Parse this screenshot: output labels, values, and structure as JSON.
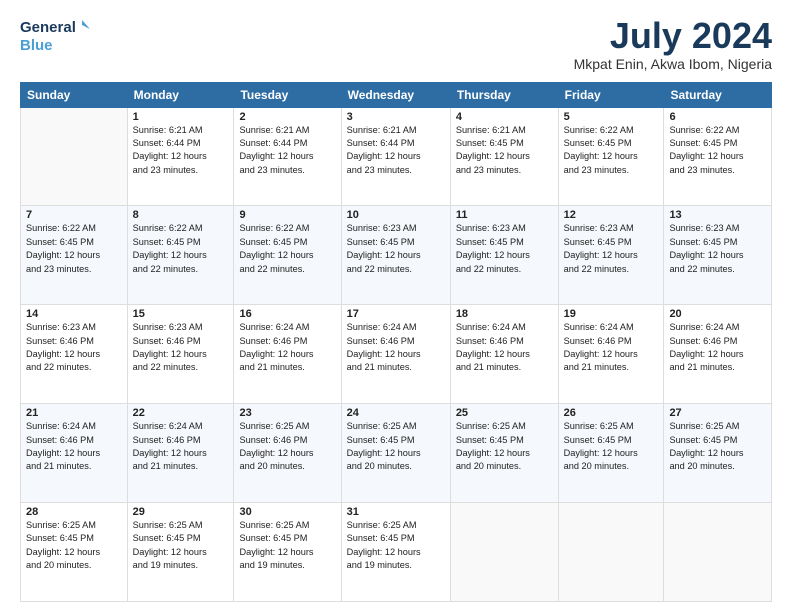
{
  "header": {
    "logo_line1": "General",
    "logo_line2": "Blue",
    "month": "July 2024",
    "location": "Mkpat Enin, Akwa Ibom, Nigeria"
  },
  "days_of_week": [
    "Sunday",
    "Monday",
    "Tuesday",
    "Wednesday",
    "Thursday",
    "Friday",
    "Saturday"
  ],
  "weeks": [
    [
      {
        "num": "",
        "info": ""
      },
      {
        "num": "1",
        "info": "Sunrise: 6:21 AM\nSunset: 6:44 PM\nDaylight: 12 hours\nand 23 minutes."
      },
      {
        "num": "2",
        "info": "Sunrise: 6:21 AM\nSunset: 6:44 PM\nDaylight: 12 hours\nand 23 minutes."
      },
      {
        "num": "3",
        "info": "Sunrise: 6:21 AM\nSunset: 6:44 PM\nDaylight: 12 hours\nand 23 minutes."
      },
      {
        "num": "4",
        "info": "Sunrise: 6:21 AM\nSunset: 6:45 PM\nDaylight: 12 hours\nand 23 minutes."
      },
      {
        "num": "5",
        "info": "Sunrise: 6:22 AM\nSunset: 6:45 PM\nDaylight: 12 hours\nand 23 minutes."
      },
      {
        "num": "6",
        "info": "Sunrise: 6:22 AM\nSunset: 6:45 PM\nDaylight: 12 hours\nand 23 minutes."
      }
    ],
    [
      {
        "num": "7",
        "info": "Sunrise: 6:22 AM\nSunset: 6:45 PM\nDaylight: 12 hours\nand 23 minutes."
      },
      {
        "num": "8",
        "info": "Sunrise: 6:22 AM\nSunset: 6:45 PM\nDaylight: 12 hours\nand 22 minutes."
      },
      {
        "num": "9",
        "info": "Sunrise: 6:22 AM\nSunset: 6:45 PM\nDaylight: 12 hours\nand 22 minutes."
      },
      {
        "num": "10",
        "info": "Sunrise: 6:23 AM\nSunset: 6:45 PM\nDaylight: 12 hours\nand 22 minutes."
      },
      {
        "num": "11",
        "info": "Sunrise: 6:23 AM\nSunset: 6:45 PM\nDaylight: 12 hours\nand 22 minutes."
      },
      {
        "num": "12",
        "info": "Sunrise: 6:23 AM\nSunset: 6:45 PM\nDaylight: 12 hours\nand 22 minutes."
      },
      {
        "num": "13",
        "info": "Sunrise: 6:23 AM\nSunset: 6:45 PM\nDaylight: 12 hours\nand 22 minutes."
      }
    ],
    [
      {
        "num": "14",
        "info": "Sunrise: 6:23 AM\nSunset: 6:46 PM\nDaylight: 12 hours\nand 22 minutes."
      },
      {
        "num": "15",
        "info": "Sunrise: 6:23 AM\nSunset: 6:46 PM\nDaylight: 12 hours\nand 22 minutes."
      },
      {
        "num": "16",
        "info": "Sunrise: 6:24 AM\nSunset: 6:46 PM\nDaylight: 12 hours\nand 21 minutes."
      },
      {
        "num": "17",
        "info": "Sunrise: 6:24 AM\nSunset: 6:46 PM\nDaylight: 12 hours\nand 21 minutes."
      },
      {
        "num": "18",
        "info": "Sunrise: 6:24 AM\nSunset: 6:46 PM\nDaylight: 12 hours\nand 21 minutes."
      },
      {
        "num": "19",
        "info": "Sunrise: 6:24 AM\nSunset: 6:46 PM\nDaylight: 12 hours\nand 21 minutes."
      },
      {
        "num": "20",
        "info": "Sunrise: 6:24 AM\nSunset: 6:46 PM\nDaylight: 12 hours\nand 21 minutes."
      }
    ],
    [
      {
        "num": "21",
        "info": "Sunrise: 6:24 AM\nSunset: 6:46 PM\nDaylight: 12 hours\nand 21 minutes."
      },
      {
        "num": "22",
        "info": "Sunrise: 6:24 AM\nSunset: 6:46 PM\nDaylight: 12 hours\nand 21 minutes."
      },
      {
        "num": "23",
        "info": "Sunrise: 6:25 AM\nSunset: 6:46 PM\nDaylight: 12 hours\nand 20 minutes."
      },
      {
        "num": "24",
        "info": "Sunrise: 6:25 AM\nSunset: 6:45 PM\nDaylight: 12 hours\nand 20 minutes."
      },
      {
        "num": "25",
        "info": "Sunrise: 6:25 AM\nSunset: 6:45 PM\nDaylight: 12 hours\nand 20 minutes."
      },
      {
        "num": "26",
        "info": "Sunrise: 6:25 AM\nSunset: 6:45 PM\nDaylight: 12 hours\nand 20 minutes."
      },
      {
        "num": "27",
        "info": "Sunrise: 6:25 AM\nSunset: 6:45 PM\nDaylight: 12 hours\nand 20 minutes."
      }
    ],
    [
      {
        "num": "28",
        "info": "Sunrise: 6:25 AM\nSunset: 6:45 PM\nDaylight: 12 hours\nand 20 minutes."
      },
      {
        "num": "29",
        "info": "Sunrise: 6:25 AM\nSunset: 6:45 PM\nDaylight: 12 hours\nand 19 minutes."
      },
      {
        "num": "30",
        "info": "Sunrise: 6:25 AM\nSunset: 6:45 PM\nDaylight: 12 hours\nand 19 minutes."
      },
      {
        "num": "31",
        "info": "Sunrise: 6:25 AM\nSunset: 6:45 PM\nDaylight: 12 hours\nand 19 minutes."
      },
      {
        "num": "",
        "info": ""
      },
      {
        "num": "",
        "info": ""
      },
      {
        "num": "",
        "info": ""
      }
    ]
  ]
}
